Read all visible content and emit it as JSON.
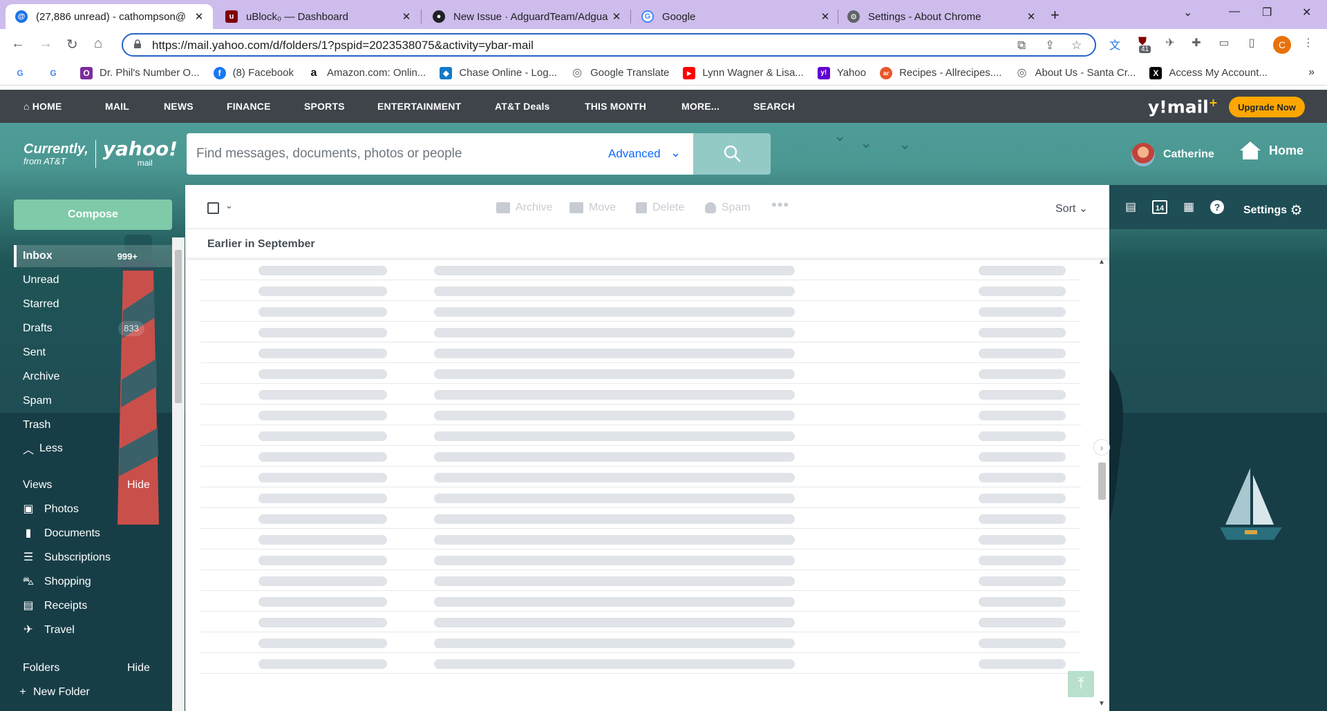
{
  "browser": {
    "tabs": [
      {
        "title": "(27,886 unread) - cathompson@",
        "favicon_color": "#1a73e8",
        "active": true
      },
      {
        "title": "uBlock₀ — Dashboard",
        "favicon_color": "#800000",
        "active": false
      },
      {
        "title": "New Issue · AdguardTeam/Adgua",
        "favicon_color": "#202124",
        "active": false
      },
      {
        "title": "Google",
        "favicon_color": "#4285f4",
        "active": false
      },
      {
        "title": "Settings - About Chrome",
        "favicon_color": "#5f6368",
        "active": false
      }
    ],
    "url": "https://mail.yahoo.com/d/folders/1?pspid=2023538075&activity=ybar-mail",
    "extension_badge": "41",
    "profile_initial": "C",
    "bookmarks": [
      {
        "label": "",
        "icon": "G",
        "color": "#4285f4"
      },
      {
        "label": "",
        "icon": "G",
        "color": "#4285f4"
      },
      {
        "label": "Dr. Phil's Number O...",
        "icon": "O",
        "color": "#7b2c9c"
      },
      {
        "label": "(8) Facebook",
        "icon": "f",
        "color": "#1877f2"
      },
      {
        "label": "Amazon.com: Onlin...",
        "icon": "a",
        "color": "#111111"
      },
      {
        "label": "Chase Online - Log...",
        "icon": "◆",
        "color": "#117aca"
      },
      {
        "label": "Google Translate",
        "icon": "◎",
        "color": "#5f6368"
      },
      {
        "label": "Lynn Wagner & Lisa...",
        "icon": "▶",
        "color": "#ff0000"
      },
      {
        "label": "Yahoo",
        "icon": "y!",
        "color": "#6001d2"
      },
      {
        "label": "Recipes - Allrecipes....",
        "icon": "ar",
        "color": "#e8562a"
      },
      {
        "label": "About Us - Santa Cr...",
        "icon": "◎",
        "color": "#5f6368"
      },
      {
        "label": "Access My Account...",
        "icon": "X",
        "color": "#000000"
      }
    ]
  },
  "ynav": {
    "items": [
      "HOME",
      "MAIL",
      "NEWS",
      "FINANCE",
      "SPORTS",
      "ENTERTAINMENT",
      "AT&T Deals",
      "THIS MONTH",
      "MORE...",
      "SEARCH"
    ],
    "logo": "y!mail",
    "logo_plus": "+",
    "upgrade": "Upgrade Now"
  },
  "header": {
    "brand_currently": "Currently,",
    "brand_from": "from AT&T",
    "brand_yahoo": "yahoo!",
    "brand_mail": "mail",
    "search_placeholder": "Find messages, documents, photos or people",
    "advanced": "Advanced",
    "user_name": "Catherine",
    "home": "Home"
  },
  "sidebar": {
    "compose": "Compose",
    "folders": [
      {
        "label": "Inbox",
        "count": "999+",
        "active": true
      },
      {
        "label": "Unread",
        "count": ""
      },
      {
        "label": "Starred",
        "count": ""
      },
      {
        "label": "Drafts",
        "count": "833"
      },
      {
        "label": "Sent",
        "count": ""
      },
      {
        "label": "Archive",
        "count": ""
      },
      {
        "label": "Spam",
        "count": ""
      },
      {
        "label": "Trash",
        "count": ""
      }
    ],
    "less": "Less",
    "views_title": "Views",
    "views_hide": "Hide",
    "views": [
      "Photos",
      "Documents",
      "Subscriptions",
      "Shopping",
      "Receipts",
      "Travel"
    ],
    "folders_title": "Folders",
    "folders_hide": "Hide",
    "new_folder": "New Folder"
  },
  "toolbar": {
    "archive": "Archive",
    "move": "Move",
    "delete": "Delete",
    "spam": "Spam",
    "more": "•••",
    "sort": "Sort"
  },
  "list": {
    "group_header": "Earlier in September",
    "placeholder_rows": 20
  },
  "rail": {
    "calendar_day": "14",
    "settings": "Settings"
  },
  "colors": {
    "accent": "#0f69ff",
    "nav_bg": "#3e444a",
    "compose": "#7fcaa8",
    "upgrade": "#ffa700"
  }
}
